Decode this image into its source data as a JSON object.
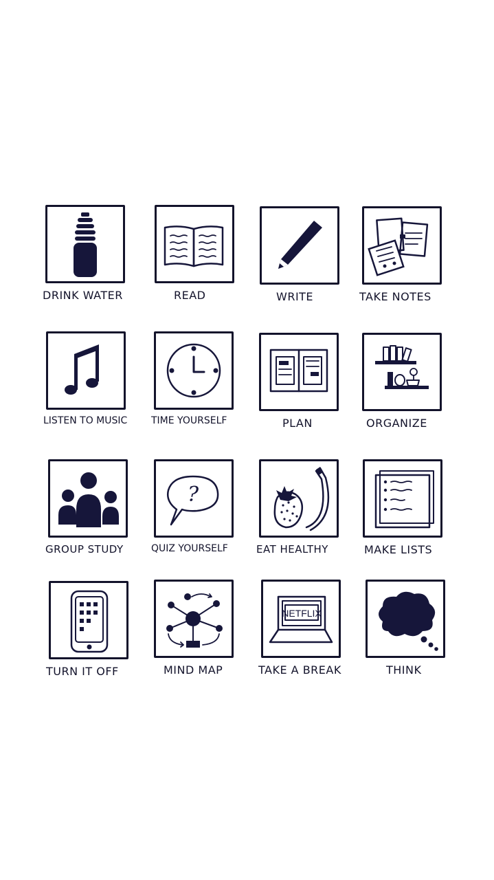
{
  "tiles": [
    {
      "label": "DRINK WATER",
      "icon": "water-bottle-icon"
    },
    {
      "label": "READ",
      "icon": "open-book-icon"
    },
    {
      "label": "WRITE",
      "icon": "pencil-icon"
    },
    {
      "label": "TAKE NOTES",
      "icon": "notes-icon"
    },
    {
      "label": "LISTEN TO MUSIC",
      "icon": "music-note-icon"
    },
    {
      "label": "TIME YOURSELF",
      "icon": "clock-icon"
    },
    {
      "label": "PLAN",
      "icon": "planner-icon"
    },
    {
      "label": "ORGANIZE",
      "icon": "shelves-icon"
    },
    {
      "label": "GROUP STUDY",
      "icon": "group-icon"
    },
    {
      "label": "QUIZ YOURSELF",
      "icon": "question-bubble-icon"
    },
    {
      "label": "EAT HEALTHY",
      "icon": "fruit-icon"
    },
    {
      "label": "MAKE LISTS",
      "icon": "checklist-icon"
    },
    {
      "label": "TURN IT OFF",
      "icon": "phone-icon"
    },
    {
      "label": "MIND MAP",
      "icon": "mind-map-icon"
    },
    {
      "label": "TAKE A BREAK",
      "icon": "laptop-netflix-icon"
    },
    {
      "label": "THINK",
      "icon": "thought-cloud-icon"
    }
  ],
  "laptop_screen_text": "NETFLIX",
  "quiz_mark": "?"
}
